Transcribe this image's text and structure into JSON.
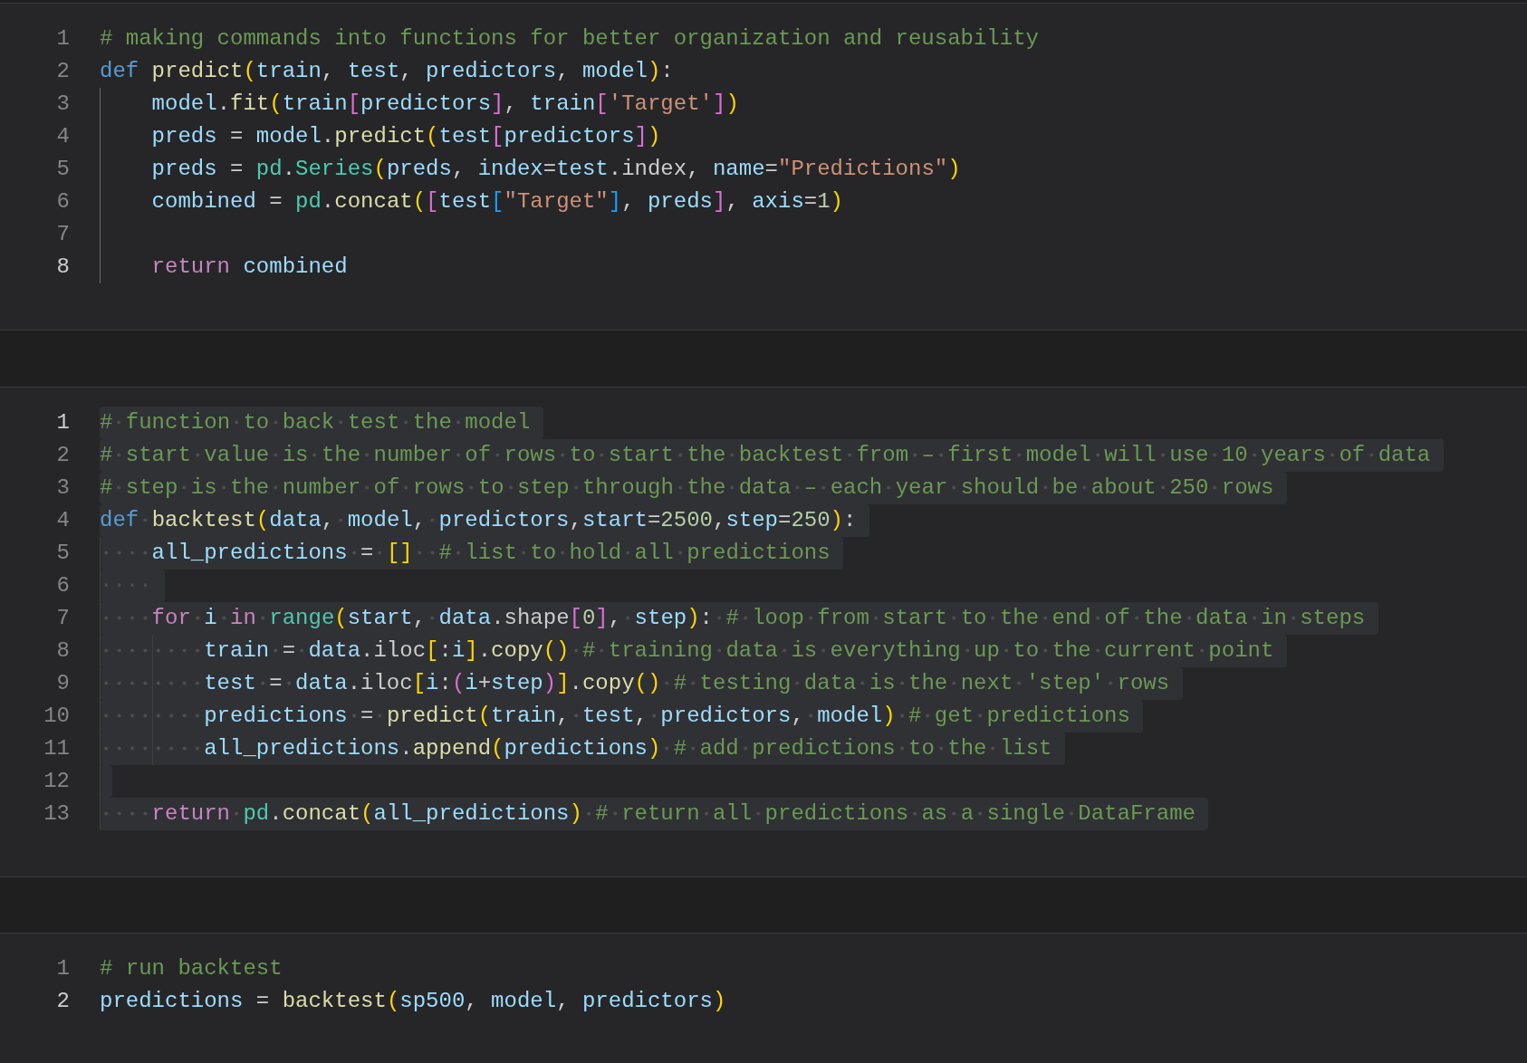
{
  "cells": [
    {
      "lines": [
        {
          "number": "1",
          "active": false,
          "selected": false,
          "tokens": [
            {
              "kind": "comment",
              "text": "# making commands into functions for better organization and reusability"
            }
          ]
        },
        {
          "number": "2",
          "active": false,
          "selected": false,
          "tokens": [
            {
              "kind": "keyword",
              "text": "def"
            },
            {
              "kind": "function",
              "text": " predict"
            },
            {
              "kind": "bracket1",
              "text": "("
            },
            {
              "kind": "variable",
              "text": "train"
            },
            {
              "kind": "plain",
              "text": ", "
            },
            {
              "kind": "variable",
              "text": "test"
            },
            {
              "kind": "plain",
              "text": ", "
            },
            {
              "kind": "variable",
              "text": "predictors"
            },
            {
              "kind": "plain",
              "text": ", "
            },
            {
              "kind": "variable",
              "text": "model"
            },
            {
              "kind": "bracket1",
              "text": ")"
            },
            {
              "kind": "plain",
              "text": ":"
            }
          ]
        },
        {
          "number": "3",
          "active": false,
          "selected": false,
          "tokens": [
            {
              "kind": "variable",
              "text": "    model"
            },
            {
              "kind": "plain",
              "text": "."
            },
            {
              "kind": "function",
              "text": "fit"
            },
            {
              "kind": "bracket1",
              "text": "("
            },
            {
              "kind": "variable",
              "text": "train"
            },
            {
              "kind": "bracket2",
              "text": "["
            },
            {
              "kind": "variable",
              "text": "predictors"
            },
            {
              "kind": "bracket2",
              "text": "]"
            },
            {
              "kind": "plain",
              "text": ", "
            },
            {
              "kind": "variable",
              "text": "train"
            },
            {
              "kind": "bracket2",
              "text": "["
            },
            {
              "kind": "string",
              "text": "'Target'"
            },
            {
              "kind": "bracket2",
              "text": "]"
            },
            {
              "kind": "bracket1",
              "text": ")"
            }
          ]
        },
        {
          "number": "4",
          "active": false,
          "selected": false,
          "tokens": [
            {
              "kind": "variable",
              "text": "    preds"
            },
            {
              "kind": "plain",
              "text": " = "
            },
            {
              "kind": "variable",
              "text": "model"
            },
            {
              "kind": "plain",
              "text": "."
            },
            {
              "kind": "function",
              "text": "predict"
            },
            {
              "kind": "bracket1",
              "text": "("
            },
            {
              "kind": "variable",
              "text": "test"
            },
            {
              "kind": "bracket2",
              "text": "["
            },
            {
              "kind": "variable",
              "text": "predictors"
            },
            {
              "kind": "bracket2",
              "text": "]"
            },
            {
              "kind": "bracket1",
              "text": ")"
            }
          ]
        },
        {
          "number": "5",
          "active": false,
          "selected": false,
          "tokens": [
            {
              "kind": "variable",
              "text": "    preds"
            },
            {
              "kind": "plain",
              "text": " = "
            },
            {
              "kind": "class",
              "text": "pd"
            },
            {
              "kind": "plain",
              "text": "."
            },
            {
              "kind": "class",
              "text": "Series"
            },
            {
              "kind": "bracket1",
              "text": "("
            },
            {
              "kind": "variable",
              "text": "preds"
            },
            {
              "kind": "plain",
              "text": ", "
            },
            {
              "kind": "variable",
              "text": "index"
            },
            {
              "kind": "plain",
              "text": "="
            },
            {
              "kind": "variable",
              "text": "test"
            },
            {
              "kind": "plain",
              "text": ".index, "
            },
            {
              "kind": "variable",
              "text": "name"
            },
            {
              "kind": "plain",
              "text": "="
            },
            {
              "kind": "string",
              "text": "\"Predictions\""
            },
            {
              "kind": "bracket1",
              "text": ")"
            }
          ]
        },
        {
          "number": "6",
          "active": false,
          "selected": false,
          "tokens": [
            {
              "kind": "variable",
              "text": "    combined"
            },
            {
              "kind": "plain",
              "text": " = "
            },
            {
              "kind": "class",
              "text": "pd"
            },
            {
              "kind": "plain",
              "text": "."
            },
            {
              "kind": "function",
              "text": "concat"
            },
            {
              "kind": "bracket1",
              "text": "("
            },
            {
              "kind": "bracket2",
              "text": "["
            },
            {
              "kind": "variable",
              "text": "test"
            },
            {
              "kind": "bracket3",
              "text": "["
            },
            {
              "kind": "string",
              "text": "\"Target\""
            },
            {
              "kind": "bracket3",
              "text": "]"
            },
            {
              "kind": "plain",
              "text": ", "
            },
            {
              "kind": "variable",
              "text": "preds"
            },
            {
              "kind": "bracket2",
              "text": "]"
            },
            {
              "kind": "plain",
              "text": ", "
            },
            {
              "kind": "variable",
              "text": "axis"
            },
            {
              "kind": "plain",
              "text": "="
            },
            {
              "kind": "number",
              "text": "1"
            },
            {
              "kind": "bracket1",
              "text": ")"
            }
          ]
        },
        {
          "number": "7",
          "active": false,
          "selected": false
        },
        {
          "number": "8",
          "active": true,
          "selected": false,
          "tokens": [
            {
              "kind": "control",
              "text": "    return"
            },
            {
              "kind": "variable",
              "text": " combined"
            }
          ]
        }
      ]
    },
    {
      "lines": [
        {
          "number": "1",
          "active": true,
          "selected": true,
          "tokens": [
            {
              "kind": "comment",
              "text": "# function to back test the model"
            }
          ]
        },
        {
          "number": "2",
          "active": false,
          "selected": true,
          "tokens": [
            {
              "kind": "comment",
              "text": "# start value is the number of rows to start the backtest from – first model will use 10 years of data"
            }
          ]
        },
        {
          "number": "3",
          "active": false,
          "selected": true,
          "tokens": [
            {
              "kind": "comment",
              "text": "# step is the number of rows to step through the data – each year should be about 250 rows"
            }
          ]
        },
        {
          "number": "4",
          "active": false,
          "selected": true,
          "tokens": [
            {
              "kind": "keyword",
              "text": "def"
            },
            {
              "kind": "function",
              "text": " backtest"
            },
            {
              "kind": "bracket1",
              "text": "("
            },
            {
              "kind": "variable",
              "text": "data"
            },
            {
              "kind": "plain",
              "text": ", "
            },
            {
              "kind": "variable",
              "text": "model"
            },
            {
              "kind": "plain",
              "text": ", "
            },
            {
              "kind": "variable",
              "text": "predictors"
            },
            {
              "kind": "plain",
              "text": ","
            },
            {
              "kind": "variable",
              "text": "start"
            },
            {
              "kind": "plain",
              "text": "="
            },
            {
              "kind": "number",
              "text": "2500"
            },
            {
              "kind": "plain",
              "text": ","
            },
            {
              "kind": "variable",
              "text": "step"
            },
            {
              "kind": "plain",
              "text": "="
            },
            {
              "kind": "number",
              "text": "250"
            },
            {
              "kind": "bracket1",
              "text": ")"
            },
            {
              "kind": "plain",
              "text": ":"
            }
          ]
        },
        {
          "number": "5",
          "active": false,
          "selected": true,
          "tokens": [
            {
              "kind": "variable",
              "text": "    all_predictions"
            },
            {
              "kind": "plain",
              "text": " = "
            },
            {
              "kind": "bracket1",
              "text": "[]"
            },
            {
              "kind": "comment",
              "text": "  # list to hold all predictions"
            }
          ]
        },
        {
          "number": "6",
          "active": false,
          "selected": true,
          "tokens": [
            {
              "kind": "whitespace",
              "text": "····"
            }
          ]
        },
        {
          "number": "7",
          "active": false,
          "selected": true,
          "tokens": [
            {
              "kind": "control",
              "text": "    for"
            },
            {
              "kind": "variable",
              "text": " i"
            },
            {
              "kind": "control",
              "text": " in"
            },
            {
              "kind": "class",
              "text": " range"
            },
            {
              "kind": "bracket1",
              "text": "("
            },
            {
              "kind": "variable",
              "text": "start"
            },
            {
              "kind": "plain",
              "text": ", "
            },
            {
              "kind": "variable",
              "text": "data"
            },
            {
              "kind": "plain",
              "text": ".shape"
            },
            {
              "kind": "bracket2",
              "text": "["
            },
            {
              "kind": "number",
              "text": "0"
            },
            {
              "kind": "bracket2",
              "text": "]"
            },
            {
              "kind": "plain",
              "text": ", "
            },
            {
              "kind": "variable",
              "text": "step"
            },
            {
              "kind": "bracket1",
              "text": ")"
            },
            {
              "kind": "plain",
              "text": ":"
            },
            {
              "kind": "comment",
              "text": " # loop from start to the end of the data in steps"
            }
          ]
        },
        {
          "number": "8",
          "active": false,
          "selected": true,
          "tokens": [
            {
              "kind": "variable",
              "text": "        train"
            },
            {
              "kind": "plain",
              "text": " = "
            },
            {
              "kind": "variable",
              "text": "data"
            },
            {
              "kind": "plain",
              "text": ".iloc"
            },
            {
              "kind": "bracket1",
              "text": "["
            },
            {
              "kind": "plain",
              "text": ":"
            },
            {
              "kind": "variable",
              "text": "i"
            },
            {
              "kind": "bracket1",
              "text": "]"
            },
            {
              "kind": "plain",
              "text": "."
            },
            {
              "kind": "function",
              "text": "copy"
            },
            {
              "kind": "bracket1",
              "text": "()"
            },
            {
              "kind": "comment",
              "text": " # training data is everything up to the current point"
            }
          ]
        },
        {
          "number": "9",
          "active": false,
          "selected": true,
          "tokens": [
            {
              "kind": "variable",
              "text": "        test"
            },
            {
              "kind": "plain",
              "text": " = "
            },
            {
              "kind": "variable",
              "text": "data"
            },
            {
              "kind": "plain",
              "text": ".iloc"
            },
            {
              "kind": "bracket1",
              "text": "["
            },
            {
              "kind": "variable",
              "text": "i"
            },
            {
              "kind": "plain",
              "text": ":"
            },
            {
              "kind": "bracket2",
              "text": "("
            },
            {
              "kind": "variable",
              "text": "i"
            },
            {
              "kind": "plain",
              "text": "+"
            },
            {
              "kind": "variable",
              "text": "step"
            },
            {
              "kind": "bracket2",
              "text": ")"
            },
            {
              "kind": "bracket1",
              "text": "]"
            },
            {
              "kind": "plain",
              "text": "."
            },
            {
              "kind": "function",
              "text": "copy"
            },
            {
              "kind": "bracket1",
              "text": "()"
            },
            {
              "kind": "comment",
              "text": " # testing data is the next 'step' rows"
            }
          ]
        },
        {
          "number": "10",
          "active": false,
          "selected": true,
          "tokens": [
            {
              "kind": "variable",
              "text": "        predictions"
            },
            {
              "kind": "plain",
              "text": " = "
            },
            {
              "kind": "function",
              "text": "predict"
            },
            {
              "kind": "bracket1",
              "text": "("
            },
            {
              "kind": "variable",
              "text": "train"
            },
            {
              "kind": "plain",
              "text": ", "
            },
            {
              "kind": "variable",
              "text": "test"
            },
            {
              "kind": "plain",
              "text": ", "
            },
            {
              "kind": "variable",
              "text": "predictors"
            },
            {
              "kind": "plain",
              "text": ", "
            },
            {
              "kind": "variable",
              "text": "model"
            },
            {
              "kind": "bracket1",
              "text": ")"
            },
            {
              "kind": "comment",
              "text": " # get predictions"
            }
          ]
        },
        {
          "number": "11",
          "active": false,
          "selected": true,
          "tokens": [
            {
              "kind": "variable",
              "text": "        all_predictions"
            },
            {
              "kind": "plain",
              "text": "."
            },
            {
              "kind": "function",
              "text": "append"
            },
            {
              "kind": "bracket1",
              "text": "("
            },
            {
              "kind": "variable",
              "text": "predictions"
            },
            {
              "kind": "bracket1",
              "text": ")"
            },
            {
              "kind": "comment",
              "text": " # add predictions to the list"
            }
          ]
        },
        {
          "number": "12",
          "active": false,
          "selected": true
        },
        {
          "number": "13",
          "active": false,
          "selected": true,
          "tokens": [
            {
              "kind": "control",
              "text": "    return"
            },
            {
              "kind": "class",
              "text": " pd"
            },
            {
              "kind": "plain",
              "text": "."
            },
            {
              "kind": "function",
              "text": "concat"
            },
            {
              "kind": "bracket1",
              "text": "("
            },
            {
              "kind": "variable",
              "text": "all_predictions"
            },
            {
              "kind": "bracket1",
              "text": ")"
            },
            {
              "kind": "comment",
              "text": " # return all predictions as a single DataFrame"
            }
          ]
        }
      ]
    },
    {
      "lines": [
        {
          "number": "1",
          "active": false,
          "selected": false,
          "tokens": [
            {
              "kind": "comment",
              "text": "# run backtest"
            }
          ]
        },
        {
          "number": "2",
          "active": true,
          "selected": false,
          "tokens": [
            {
              "kind": "variable",
              "text": "predictions"
            },
            {
              "kind": "plain",
              "text": " = "
            },
            {
              "kind": "function",
              "text": "backtest"
            },
            {
              "kind": "bracket1",
              "text": "("
            },
            {
              "kind": "variable",
              "text": "sp500"
            },
            {
              "kind": "plain",
              "text": ", "
            },
            {
              "kind": "variable",
              "text": "model"
            },
            {
              "kind": "plain",
              "text": ", "
            },
            {
              "kind": "variable",
              "text": "predictors"
            },
            {
              "kind": "bracket1",
              "text": ")"
            }
          ]
        }
      ]
    }
  ]
}
